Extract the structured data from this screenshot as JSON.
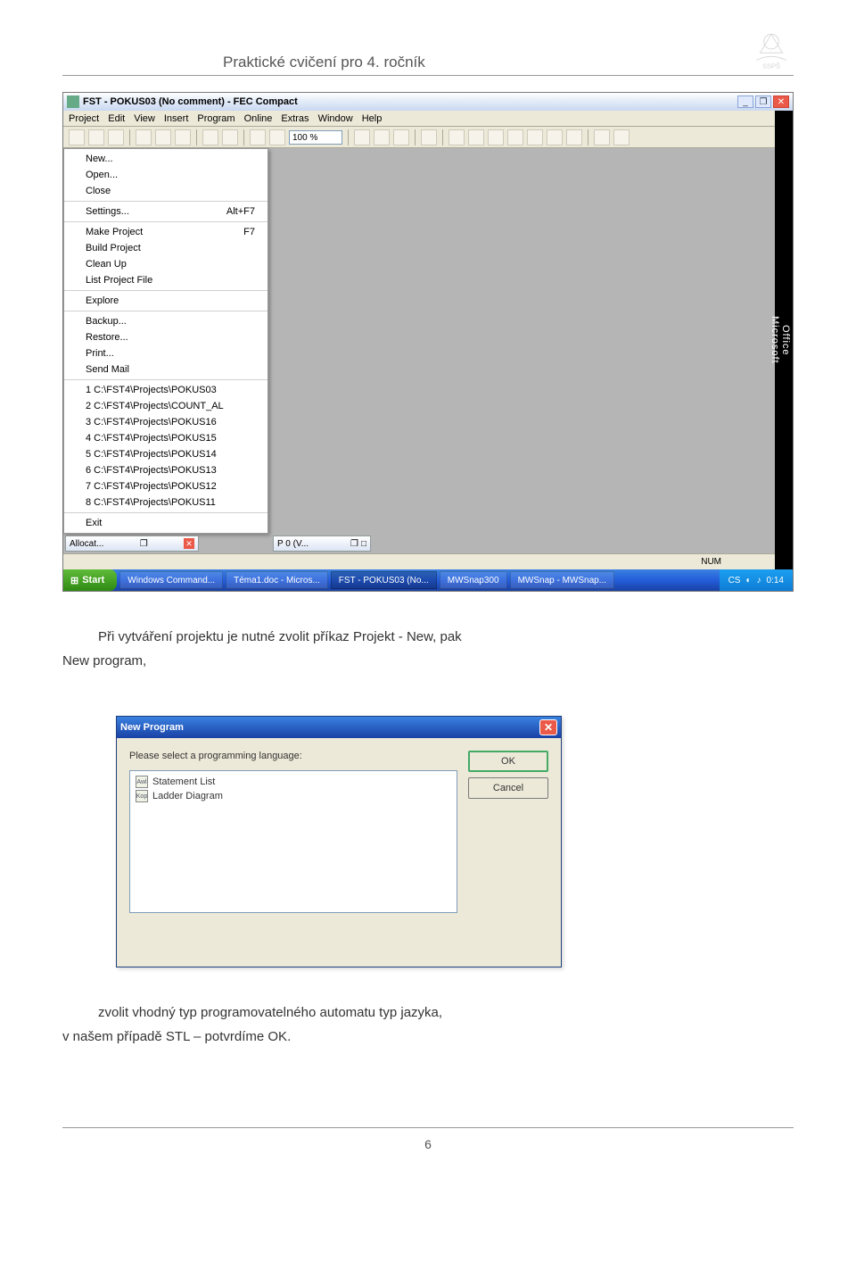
{
  "doc": {
    "header_title": "Praktické cvičení pro 4. ročník",
    "logo_caption": "SSPŠ",
    "page_number": "6"
  },
  "ide": {
    "title": "FST - POKUS03 (No comment) - FEC Compact",
    "menubar": [
      "Project",
      "Edit",
      "View",
      "Insert",
      "Program",
      "Online",
      "Extras",
      "Window",
      "Help"
    ],
    "zoom": "100 %",
    "dropdown": {
      "sec1": [
        {
          "label": "New...",
          "accel": ""
        },
        {
          "label": "Open...",
          "accel": ""
        },
        {
          "label": "Close",
          "accel": ""
        }
      ],
      "sec2": [
        {
          "label": "Settings...",
          "accel": "Alt+F7"
        }
      ],
      "sec3": [
        {
          "label": "Make Project",
          "accel": "F7"
        },
        {
          "label": "Build Project",
          "accel": ""
        },
        {
          "label": "Clean Up",
          "accel": ""
        },
        {
          "label": "List Project File",
          "accel": ""
        }
      ],
      "sec4": [
        {
          "label": "Explore",
          "accel": ""
        }
      ],
      "sec5": [
        {
          "label": "Backup...",
          "accel": ""
        },
        {
          "label": "Restore...",
          "accel": ""
        },
        {
          "label": "Print...",
          "accel": ""
        },
        {
          "label": "Send Mail",
          "accel": ""
        }
      ],
      "sec6": [
        {
          "label": "1 C:\\FST4\\Projects\\POKUS03",
          "accel": ""
        },
        {
          "label": "2 C:\\FST4\\Projects\\COUNT_AL",
          "accel": ""
        },
        {
          "label": "3 C:\\FST4\\Projects\\POKUS16",
          "accel": ""
        },
        {
          "label": "4 C:\\FST4\\Projects\\POKUS15",
          "accel": ""
        },
        {
          "label": "5 C:\\FST4\\Projects\\POKUS14",
          "accel": ""
        },
        {
          "label": "6 C:\\FST4\\Projects\\POKUS13",
          "accel": ""
        },
        {
          "label": "7 C:\\FST4\\Projects\\POKUS12",
          "accel": ""
        },
        {
          "label": "8 C:\\FST4\\Projects\\POKUS11",
          "accel": ""
        }
      ],
      "sec7": [
        {
          "label": "Exit",
          "accel": ""
        }
      ]
    },
    "pane_alloc": "Allocat...",
    "pane_pov": "P 0 (V...",
    "status_num": "NUM",
    "office_label_top": "Office",
    "office_label_bottom": "Microsoft",
    "taskbar": {
      "start": "Start",
      "items": [
        "Windows Command...",
        "Téma1.doc - Micros...",
        "FST - POKUS03 (No...",
        "MWSnap300",
        "MWSnap - MWSnap..."
      ],
      "tray_left": "CS",
      "clock": "0:14"
    }
  },
  "para": {
    "line1": "Při vytváření projektu je nutné zvolit příkaz Projekt - New, pak",
    "line2": "New program,"
  },
  "dialog": {
    "title": "New Program",
    "prompt": "Please select a programming language:",
    "items": [
      {
        "ico": "Awl",
        "label": "Statement List"
      },
      {
        "ico": "Kop",
        "label": "Ladder Diagram"
      }
    ],
    "ok": "OK",
    "cancel": "Cancel"
  },
  "para2": {
    "line1": "zvolit vhodný typ programovatelného automatu typ jazyka,",
    "line2": "v našem případě STL – potvrdíme OK."
  }
}
